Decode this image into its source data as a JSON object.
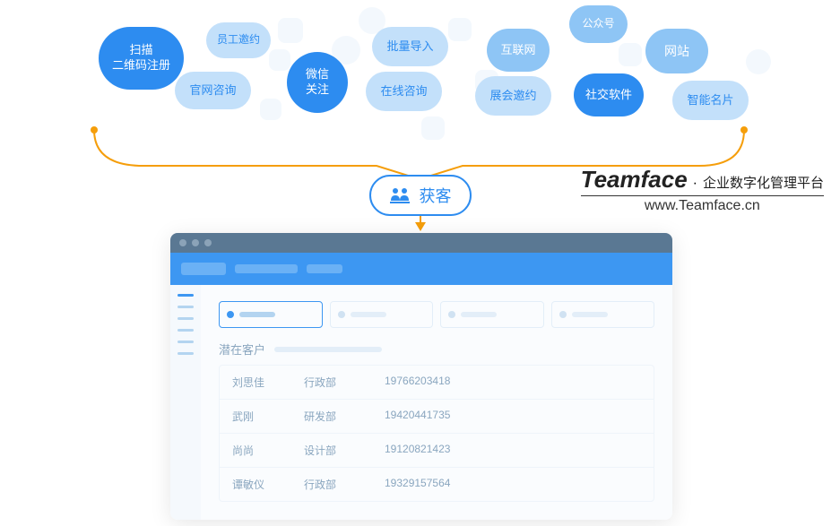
{
  "bubbles": {
    "scan_qr": "扫描\n二维码注册",
    "employee_invite": "员工邀约",
    "official_consult": "官网咨询",
    "wechat_follow": "微信\n关注",
    "batch_import": "批量导入",
    "online_consult": "在线咨询",
    "internet": "互联网",
    "exhibition": "展会邀约",
    "official_account": "公众号",
    "website": "网站",
    "social": "社交软件",
    "smart_card": "智能名片"
  },
  "center": {
    "label": "获客"
  },
  "brand": {
    "name": "Teamface",
    "dot": "·",
    "tagline": "企业数字化管理平台",
    "url": "www.Teamface.cn"
  },
  "app": {
    "section_label": "潜在客户",
    "rows": [
      {
        "name": "刘思佳",
        "dept": "行政部",
        "phone": "19766203418"
      },
      {
        "name": "武刚",
        "dept": "研发部",
        "phone": "19420441735"
      },
      {
        "name": "尚尚",
        "dept": "设计部",
        "phone": "19120821423"
      },
      {
        "name": "谭敏仪",
        "dept": "行政部",
        "phone": "19329157564"
      }
    ]
  }
}
